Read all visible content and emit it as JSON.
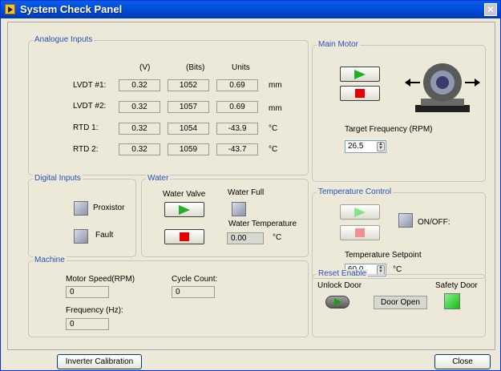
{
  "window": {
    "title": "System Check Panel"
  },
  "analogue": {
    "label": "Analogue Inputs",
    "headers": [
      "(V)",
      "(Bits)",
      "Units"
    ],
    "rows": [
      {
        "name": "LVDT #1:",
        "v": "0.32",
        "bits": "1052",
        "units": "0.69",
        "unit_label": "mm"
      },
      {
        "name": "LVDT #2:",
        "v": "0.32",
        "bits": "1057",
        "units": "0.69",
        "unit_label": "mm"
      },
      {
        "name": "RTD 1:",
        "v": "0.32",
        "bits": "1054",
        "units": "-43.9",
        "unit_label": "°C"
      },
      {
        "name": "RTD 2:",
        "v": "0.32",
        "bits": "1059",
        "units": "-43.7",
        "unit_label": "°C"
      }
    ]
  },
  "main_motor": {
    "label": "Main Motor",
    "target_freq_label": "Target Frequency (RPM)",
    "target_freq_value": "26.5"
  },
  "digital": {
    "label": "Digital Inputs",
    "proxistor_label": "Proxistor",
    "fault_label": "Fault"
  },
  "water": {
    "label": "Water",
    "valve_label": "Water Valve",
    "full_label": "Water Full",
    "temp_label": "Water Temperature",
    "temp_value": "0.00",
    "temp_unit": "°C"
  },
  "temperature_control": {
    "label": "Temperature Control",
    "onoff_label": "ON/OFF:",
    "setpoint_label": "Temperature Setpoint",
    "setpoint_value": "60.0",
    "setpoint_unit": "°C"
  },
  "machine": {
    "label": "Machine",
    "motor_speed_label": "Motor Speed(RPM)",
    "motor_speed_value": "0",
    "cycle_count_label": "Cycle Count:",
    "cycle_count_value": "0",
    "frequency_label": "Frequency (Hz):",
    "frequency_value": "0"
  },
  "reset_enable": {
    "label": "Reset Enable",
    "unlock_label": "Unlock Door",
    "door_status": "Door Open",
    "safety_label": "Safety Door"
  },
  "footer": {
    "inverter_label": "Inverter Calibration",
    "close_label": "Close"
  },
  "colors": {
    "title_bar": "#0450dc",
    "group_label": "#2850b8",
    "led_green": "#10c010",
    "play_green": "#22b022",
    "stop_red": "#e80000"
  }
}
